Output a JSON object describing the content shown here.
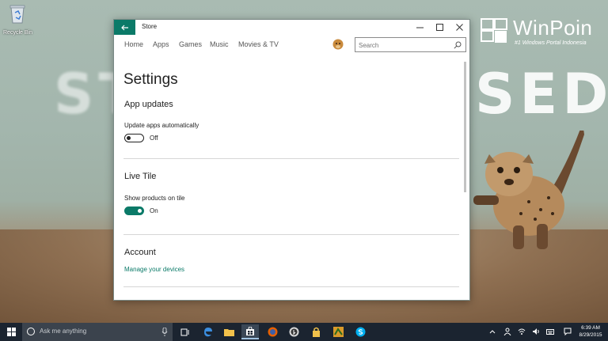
{
  "desktop": {
    "recycle_bin_label": "Recycle Bin",
    "wallpaper_text_left": "ST",
    "wallpaper_text_right": "SED",
    "brand": {
      "name": "WinPoin",
      "tagline": "#1 Windows Portal Indonesia"
    }
  },
  "window": {
    "title": "Store",
    "accent_color": "#0b7a68",
    "controls": [
      "minimize",
      "maximize",
      "close"
    ]
  },
  "nav": {
    "items": [
      "Home",
      "Apps",
      "Games",
      "Music",
      "Movies & TV"
    ],
    "search_placeholder": "Search"
  },
  "settings": {
    "title": "Settings",
    "app_updates": {
      "heading": "App updates",
      "label": "Update apps automatically",
      "state": "Off"
    },
    "live_tile": {
      "heading": "Live Tile",
      "label": "Show products on tile",
      "state": "On"
    },
    "account": {
      "heading": "Account",
      "link": "Manage your devices"
    }
  },
  "taskbar": {
    "search_placeholder": "Ask me anything",
    "pinned_icons": [
      "task-view-icon",
      "edge-icon",
      "file-explorer-icon",
      "store-icon",
      "firefox-icon",
      "media-icon",
      "lock-icon",
      "winamp-icon",
      "skype-icon"
    ],
    "clock_time": "6:39 AM",
    "clock_date": "8/29/2015"
  }
}
